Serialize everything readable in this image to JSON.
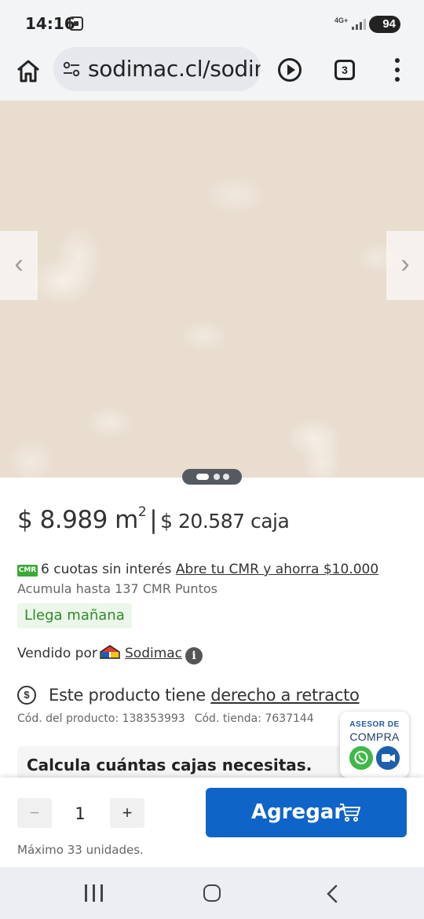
{
  "status_bar": {
    "time": "14:16",
    "network": "4G+",
    "battery": "94"
  },
  "browser": {
    "url": "sodimac.cl/sodimac",
    "tab_count": "3"
  },
  "gallery": {
    "slides": 3,
    "active_slide": 1
  },
  "product": {
    "price_m2": "$ 8.989 m",
    "price_m2_sup": "2",
    "separator": "|",
    "price_caja": "$ 20.587 caja",
    "cmr_logo_text": "CMR",
    "cuotas_text": "6 cuotas sin interés ",
    "cmr_link": "Abre tu CMR y ahorra $10.000",
    "puntos": "Acumula hasta 137 CMR Puntos",
    "delivery_badge": "Llega mañana",
    "vendido_label": "Vendido por",
    "seller": "Sodimac",
    "info_glyph": "i",
    "retracto_prefix": "Este producto tiene ",
    "retracto_link": "derecho a retracto",
    "cod_producto": "Cód. del producto: 138353993",
    "cod_tienda": "Cód. tienda: 7637144",
    "calc_title": "Calcula cuántas cajas necesitas."
  },
  "asesor": {
    "line1": "ASESOR DE",
    "line2": "COMPRA"
  },
  "purchase": {
    "minus": "−",
    "quantity": "1",
    "plus": "+",
    "add_button": "Agregar",
    "max_note": "Máximo 33 unidades."
  },
  "colors": {
    "accent": "#0f64c8",
    "delivery_green": "#2e8b2b",
    "cmr_green": "#3aa935",
    "whatsapp": "#3fb849",
    "tile": "#e9ddd0"
  }
}
